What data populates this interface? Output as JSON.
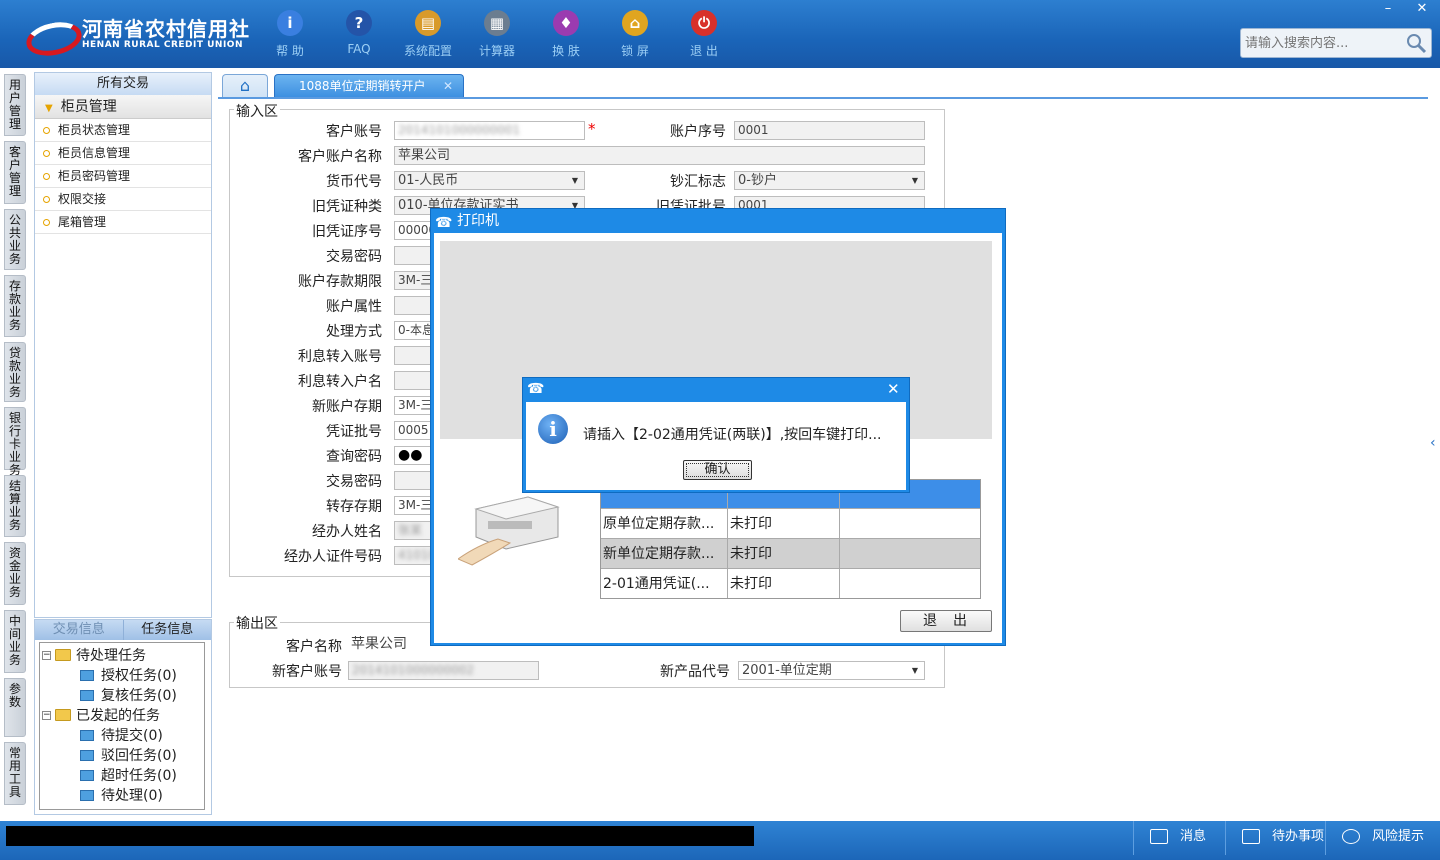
{
  "app": {
    "logo_cn": "河南省农村信用社",
    "logo_en": "HENAN RURAL CREDIT UNION",
    "toolbar": [
      {
        "label": "帮 助",
        "icon": "info-icon",
        "color": "#3a7fe0"
      },
      {
        "label": "FAQ",
        "icon": "question-icon",
        "color": "#2454a8"
      },
      {
        "label": "系统配置",
        "icon": "toolbox-icon",
        "color": "#d89a2a"
      },
      {
        "label": "计算器",
        "icon": "calculator-icon",
        "color": "#6b7d90"
      },
      {
        "label": "换 肤",
        "icon": "shirt-icon",
        "color": "#9b3bb0"
      },
      {
        "label": "锁 屏",
        "icon": "lock-icon",
        "color": "#e0a520"
      },
      {
        "label": "退 出",
        "icon": "power-icon",
        "color": "#d8302a"
      }
    ],
    "window_controls": {
      "minimize": "–",
      "close": "✕"
    },
    "search_placeholder": "请输入搜索内容..."
  },
  "vertical_tabs": [
    "用户管理",
    "客户管理",
    "公共业务",
    "存款业务",
    "贷款业务",
    "银行卡业务",
    "结算业务",
    "资金业务",
    "中间业务",
    "参数",
    "常用工具"
  ],
  "left_panel": {
    "title": "所有交易",
    "group": "柜员管理",
    "items": [
      "柜员状态管理",
      "柜员信息管理",
      "柜员密码管理",
      "权限交接",
      "尾箱管理"
    ]
  },
  "task_panel": {
    "tabs": [
      "交易信息",
      "任务信息"
    ],
    "tree": {
      "pending": "待处理任务",
      "pending_children": [
        "授权任务(0)",
        "复核任务(0)"
      ],
      "initiated": "已发起的任务",
      "initiated_children": [
        "待提交(0)",
        "驳回任务(0)",
        "超时任务(0)",
        "待处理(0)"
      ]
    }
  },
  "tabs": {
    "home_icon": "home-icon",
    "active": "1088单位定期销转开户",
    "close": "✕"
  },
  "form": {
    "input_area": "输入区",
    "output_area": "输出区",
    "labels": [
      "客户账号",
      "客户账户名称",
      "货币代号",
      "旧凭证种类",
      "旧凭证序号",
      "交易密码",
      "账户存款期限",
      "账户属性",
      "处理方式",
      "利息转入账号",
      "利息转入户名",
      "新账户存期",
      "凭证批号",
      "查询密码",
      "交易密码",
      "转存存期",
      "经办人姓名",
      "经办人证件号码"
    ],
    "values": {
      "customer_account": "2014101000000001",
      "required_mark": "*",
      "account_seq_label": "账户序号",
      "account_seq": "0001",
      "account_name": "苹果公司",
      "currency": "01-人民币",
      "cash_flag_label": "钞汇标志",
      "cash_flag": "0-钞户",
      "old_voucher_type": "010-单位存款证实书",
      "old_voucher_batch_label": "旧凭证批号",
      "old_voucher_batch": "0001",
      "old_voucher_seq": "00000",
      "deposit_term": "3M-三",
      "process_method": "0-本息",
      "new_term": "3M-三",
      "voucher_batch": "0005",
      "query_pwd": "●●",
      "rollover_term": "3M-三",
      "operator_name": "张某",
      "operator_id": "410101"
    },
    "output": {
      "customer_name_label": "客户名称",
      "customer_name": "苹果公司",
      "new_account_label": "新客户账号",
      "new_account": "2014101000000002",
      "new_product_label": "新产品代号",
      "new_product": "2001-单位定期"
    }
  },
  "printer_dialog": {
    "title": "打印机",
    "rows": [
      [
        "原单位定期存款...",
        "未打印",
        ""
      ],
      [
        "新单位定期存款...",
        "未打印",
        ""
      ],
      [
        "2-01通用凭证(...",
        "未打印",
        ""
      ]
    ],
    "exit_label": "退出"
  },
  "alert_dialog": {
    "message": "请插入【2-02通用凭证(两联)】,按回车键打印...",
    "ok_label": "确认",
    "close": "✕"
  },
  "status_bar": {
    "message_label": "消息",
    "todo_label": "待办事项",
    "risk_label": "风险提示"
  }
}
